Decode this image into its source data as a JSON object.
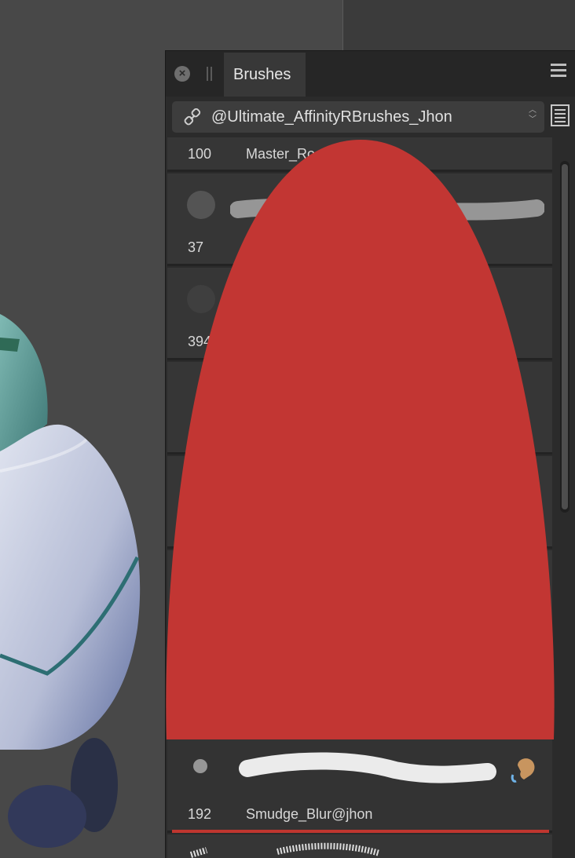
{
  "panel": {
    "tab_label": "Brushes",
    "category_selector": "@Ultimate_AffinityRBrushes_Jhon",
    "close_icon": "close-icon",
    "menu_icon": "hamburger-menu-icon",
    "list_view_icon": "list-view-icon"
  },
  "brushes": [
    {
      "size": "100",
      "name": "Master_Ro"
    },
    {
      "size": "37",
      "name": ""
    },
    {
      "size": "394",
      "name": ""
    },
    {
      "size": "192",
      "name": "Smudge_Blur@jhon"
    }
  ],
  "colors": {
    "accent_red": "#c0362f",
    "panel_bg": "#2b2b2b",
    "canvas_bg": "#484848"
  }
}
